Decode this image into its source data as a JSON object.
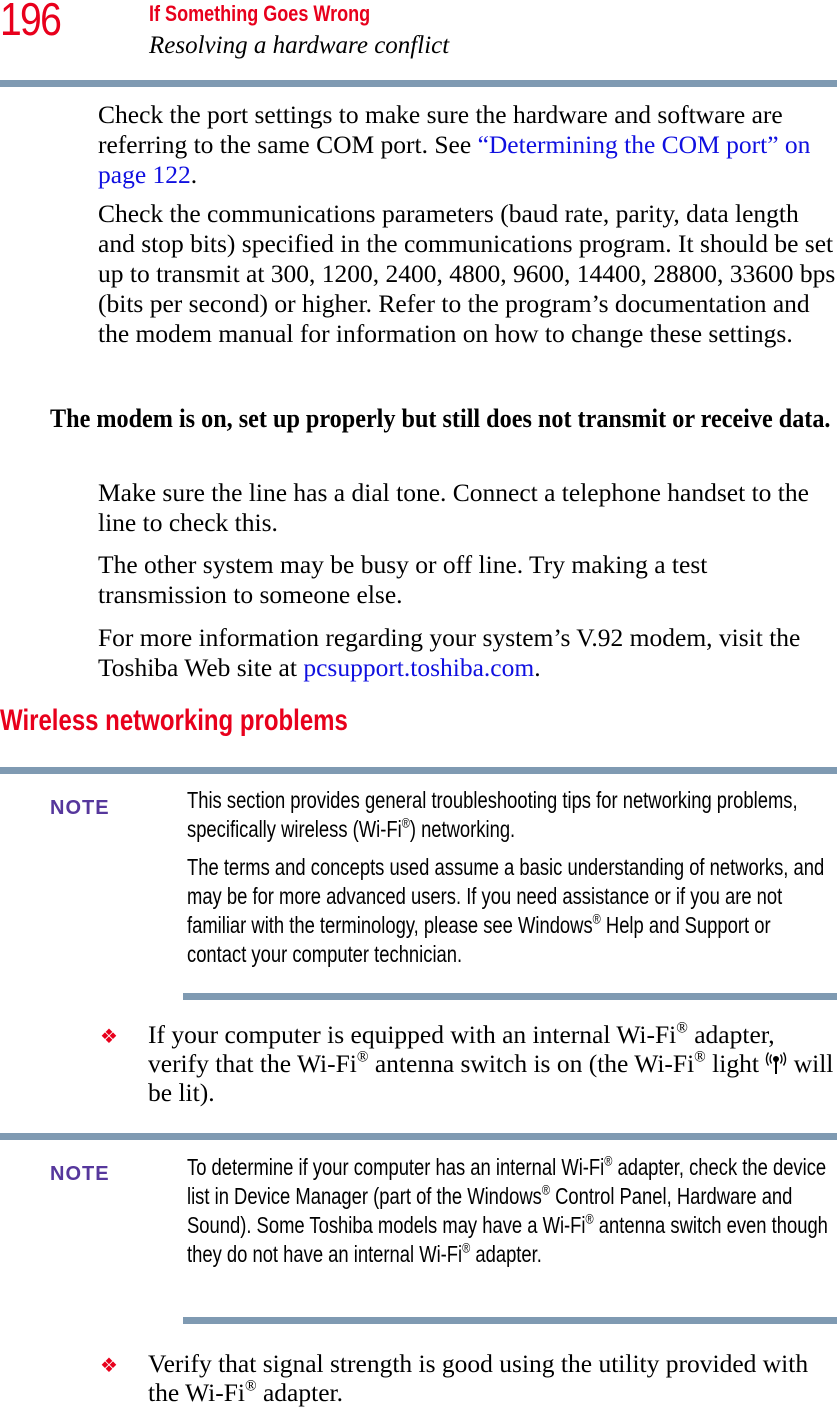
{
  "header": {
    "page_number": "196",
    "chapter_title": "If Something Goes Wrong",
    "section_title": "Resolving a hardware conflict"
  },
  "body": {
    "para_port_settings": {
      "text": "Check the port settings to make sure the hardware and software are referring to the same COM port. See ",
      "link_text": "“Determining the COM port” on page 122",
      "after": "."
    },
    "para_comm_params": "Check the communications parameters (baud rate, parity, data length and stop bits) specified in the communications program. It should be set up to transmit at 300, 1200, 2400, 4800, 9600, 14400, 28800, 33600 bps (bits per second) or higher. Refer to the program’s documentation and the modem manual for information on how to change these settings.",
    "problem_heading": "The modem is on, set up properly but still does not transmit or receive data.",
    "para_dial_tone": "Make sure the line has a dial tone. Connect a telephone handset to the line to check this.",
    "para_busy": "The other system may be busy or off line. Try making a test transmission to someone else.",
    "para_more_info": {
      "text": "For more information regarding your system’s V.92 modem, visit the Toshiba Web site at ",
      "link_text": "pcsupport.toshiba.com",
      "after": "."
    }
  },
  "wireless_section": {
    "heading": "Wireless networking problems",
    "note1": {
      "label": "NOTE",
      "para1_a": "This section provides general troubleshooting tips for networking problems, specifically wireless (Wi-Fi",
      "para1_b": ") networking.",
      "para2_a": "The terms and concepts used assume a basic understanding of networks, and may be for more advanced users. If you need assistance or if you are not familiar with the terminology, please see Windows",
      "para2_b": " Help and Support or contact your computer technician."
    },
    "bullet1": {
      "part1": "If your computer is equipped with an internal Wi-Fi",
      "part2": " adapter, verify that the Wi-Fi",
      "part3": " antenna switch is on (the Wi-Fi",
      "part4": " light ",
      "part5": " will be lit)."
    },
    "note2": {
      "label": "NOTE",
      "part1": "To determine if your computer has an internal Wi-Fi",
      "part2": " adapter, check the device list in Device Manager (part of the Windows",
      "part3": " Control Panel, Hardware and Sound). Some Toshiba models may have a Wi-Fi",
      "part4": " antenna switch even though they do not have an internal Wi-Fi",
      "part5": " adapter."
    },
    "bullet2": {
      "part1": "Verify that signal strength is good using the utility provided with the Wi-Fi",
      "part2": " adapter."
    },
    "registered_mark": "®",
    "bullet_glyph": "❖"
  },
  "colors": {
    "accent_red": "#e8001c",
    "rule_blue_gray": "#7f9ab2",
    "note_purple": "#56379c",
    "link_blue": "#1010e0"
  }
}
